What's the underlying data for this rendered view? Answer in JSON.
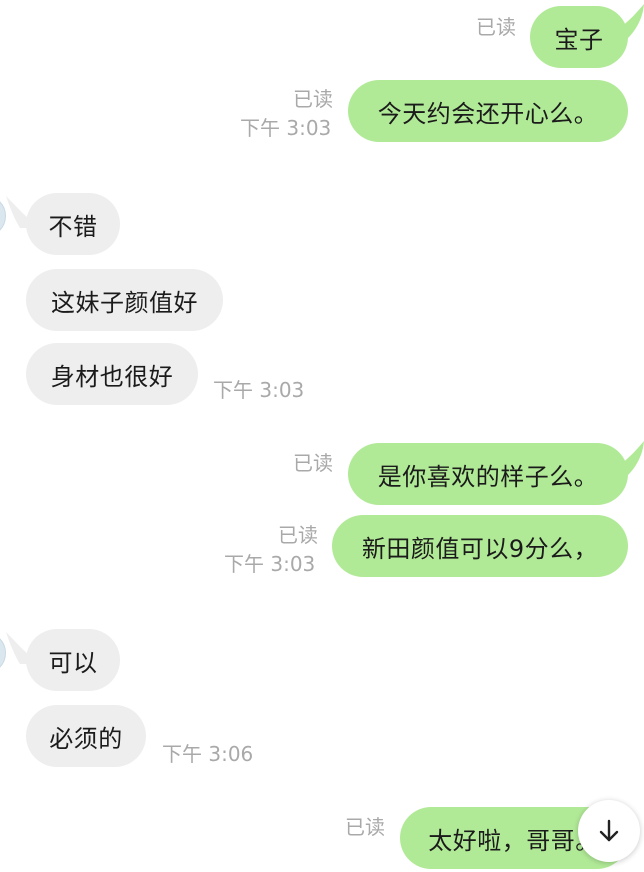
{
  "colors": {
    "outgoing_bubble": "#b1ea97",
    "incoming_bubble": "#eeeeee",
    "meta_text": "#a9a9a9",
    "message_text": "#1b1b1b"
  },
  "messages": [
    {
      "side": "out",
      "text": "宝子",
      "read": "已读"
    },
    {
      "side": "out",
      "text": "今天约会还开心么。",
      "read": "已读",
      "time": "下午 3:03"
    },
    {
      "side": "in",
      "text": "不错"
    },
    {
      "side": "in",
      "text": "这妹子颜值好"
    },
    {
      "side": "in",
      "text": "身材也很好",
      "time": "下午 3:03"
    },
    {
      "side": "out",
      "text": "是你喜欢的样子么。",
      "read": "已读"
    },
    {
      "side": "out",
      "text": "新田颜值可以9分么，",
      "read": "已读",
      "time": "下午 3:03"
    },
    {
      "side": "in",
      "text": "可以"
    },
    {
      "side": "in",
      "text": "必须的",
      "time": "下午 3:06"
    },
    {
      "side": "out",
      "text": "太好啦，哥哥。",
      "read": "已读"
    }
  ],
  "scroll_button": {
    "icon": "arrow-down-icon"
  }
}
